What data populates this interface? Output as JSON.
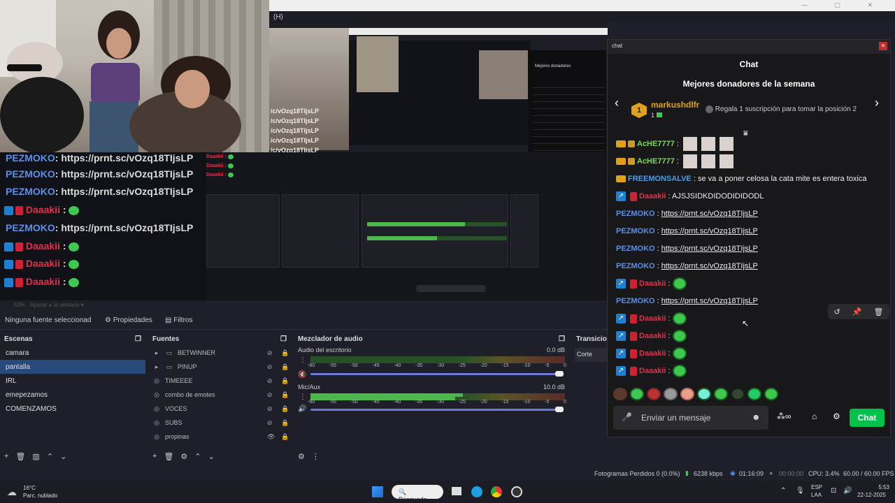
{
  "obs": {
    "menu_label": "(H)",
    "zoom_label": "53%",
    "fit_label": "Ajustar a la ventana",
    "no_source_label": "Ninguna fuente seleccionad",
    "properties_btn": "Propiedades",
    "filters_btn": "Filtros",
    "scenes": {
      "title": "Escenas",
      "items": [
        "camara",
        "pantalla",
        "IRL",
        "emepezamos",
        "COMENZAMOS"
      ],
      "selected": "pantalla"
    },
    "sources": {
      "title": "Fuentes",
      "items": [
        {
          "name": "BETWINNER",
          "icon": "folder-icon"
        },
        {
          "name": "PINUP",
          "icon": "folder-icon"
        },
        {
          "name": "TIMEEEE",
          "icon": "browser-icon"
        },
        {
          "name": "combo de emotes",
          "icon": "browser-icon"
        },
        {
          "name": "VOCES",
          "icon": "browser-icon"
        },
        {
          "name": "SUBS",
          "icon": "browser-icon"
        },
        {
          "name": "propinas",
          "icon": "browser-icon"
        }
      ]
    },
    "mixer": {
      "title": "Mezclador de audio",
      "channels": [
        {
          "name": "Audio del escritorio",
          "db": "0.0 dB",
          "level": 0
        },
        {
          "name": "Mic/Aux",
          "db": "10.0 dB",
          "level": 0.6
        }
      ],
      "ticks": [
        "-60",
        "-55",
        "-50",
        "-45",
        "-40",
        "-35",
        "-30",
        "-25",
        "-20",
        "-15",
        "-10",
        "-5",
        "0"
      ]
    },
    "transitions": {
      "title": "Transiciones",
      "value": "Corte"
    },
    "status": {
      "dropped": "Fotogramas Perdidos 0 (0.0%)",
      "kbps": "6238 kbps",
      "live_time": "01:16:09",
      "rec_time": "00:00:00",
      "cpu": "CPU: 3.4%",
      "fps": "60.00 / 60.00 FPS"
    }
  },
  "preview": {
    "overlay_lines": [
      {
        "user": "PEZMOKO",
        "text": ": https://prnt.sc/vOzq18TIjsLP"
      },
      {
        "user": "PEZMOKO",
        "text": ": https://prnt.sc/vOzq18TIjsLP"
      },
      {
        "user": "PEZMOKO",
        "text": ": https://prnt.sc/vOzq18TIjsLP"
      },
      {
        "user": "Daaakii",
        "text": ":"
      },
      {
        "user": "PEZMOKO",
        "text": ": https://prnt.sc/vOzq18TIjsLP"
      },
      {
        "user": "Daaakii",
        "text": ":"
      },
      {
        "user": "Daaakii",
        "text": ":"
      },
      {
        "user": "Daaakii",
        "text": ":"
      }
    ],
    "top_lines": [
      "/c/vOzq18TIjsLP",
      "/c/vOzq18TIjsLP",
      "/c/vOzq18TIjsLP",
      "/c/vOzq18TIjsLP",
      "/c/vOzq18TIjsLP"
    ]
  },
  "chat": {
    "window_title": "chat",
    "header": "Chat",
    "donors_title": "Mejores donadores de la semana",
    "top_donor": {
      "rank": "1",
      "name": "markushdlfr",
      "count": "1"
    },
    "gift_text": "Regala 1 suscripción para tomar la posición 2",
    "messages": [
      {
        "user": "AcHE7777",
        "text": ":",
        "type": "pics"
      },
      {
        "user": "AcHE7777",
        "text": ":",
        "type": "pics"
      },
      {
        "user": "FREEMONSALVE",
        "text": ": se va a poner celosa la cata mite es entera toxica",
        "type": "text"
      },
      {
        "user": "Daaakii",
        "text": ": AJSJSIDKDIDODIDIDODL",
        "type": "text"
      },
      {
        "user": "PEZMOKO",
        "text": "https://prnt.sc/vOzq18TIjsLP",
        "type": "link"
      },
      {
        "user": "PEZMOKO",
        "text": "https://prnt.sc/vOzq18TIjsLP",
        "type": "link"
      },
      {
        "user": "PEZMOKO",
        "text": "https://prnt.sc/vOzq18TIjsLP",
        "type": "link"
      },
      {
        "user": "PEZMOKO",
        "text": "https://prnt.sc/vOzq18TIjsLP",
        "type": "link"
      },
      {
        "user": "Daaakii",
        "text": ":",
        "type": "emote"
      },
      {
        "user": "PEZMOKO",
        "text": "https://prnt.sc/vOzq18TIjsLP",
        "type": "link"
      },
      {
        "user": "Daaakii",
        "text": ":",
        "type": "emote"
      },
      {
        "user": "Daaakii",
        "text": ":",
        "type": "emote"
      },
      {
        "user": "Daaakii",
        "text": ":",
        "type": "emote"
      },
      {
        "user": "Daaakii",
        "text": ":",
        "type": "emote"
      }
    ],
    "input_placeholder": "Enviar un mensaje",
    "send_label": "Chat",
    "colors": {
      "pezmoko": "#5b8fe8",
      "daaakii": "#e0304d",
      "ache": "#7cd957",
      "freemonsalve": "#4a9ee8",
      "accent": "#00c24a"
    }
  },
  "taskbar": {
    "weather_temp": "16°C",
    "weather_text": "Parc. nublado",
    "search_label": "Búsqueda",
    "lang": "ESP",
    "lang2": "LAA",
    "time": "5:53",
    "date": "22-12-2025"
  }
}
